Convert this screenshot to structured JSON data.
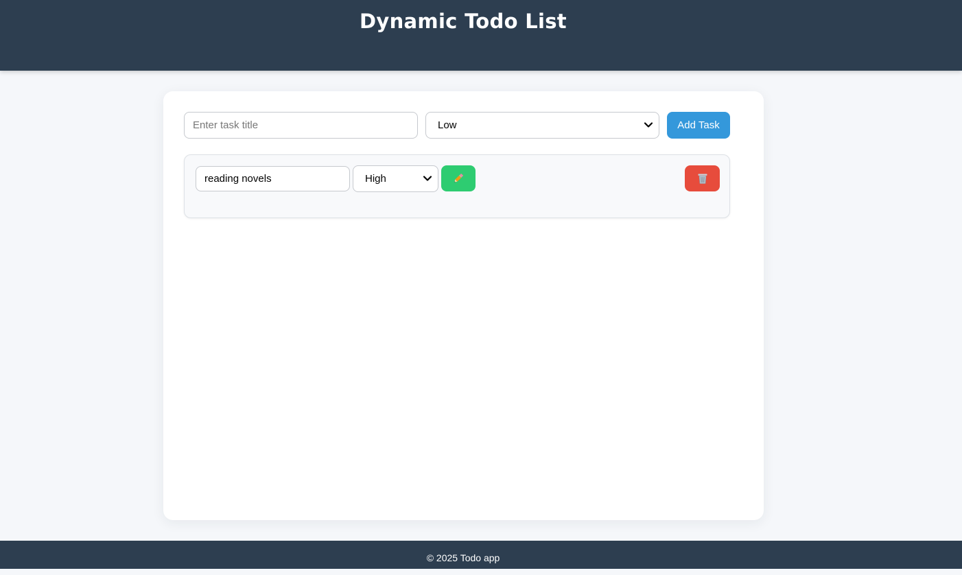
{
  "header": {
    "title": "Dynamic Todo List"
  },
  "form": {
    "title_placeholder": "Enter task title",
    "title_value": "",
    "priority_selected": "Low",
    "add_button_label": "Add Task"
  },
  "tasks": [
    {
      "title": "reading novels",
      "priority": "High",
      "edit_icon": "pencil-icon",
      "delete_icon": "trash-icon"
    }
  ],
  "footer": {
    "text": "© 2025 Todo app"
  },
  "colors": {
    "header_bg": "#2d3e50",
    "add_button": "#3498db",
    "edit_button": "#2ecc71",
    "delete_button": "#e74c3c"
  }
}
